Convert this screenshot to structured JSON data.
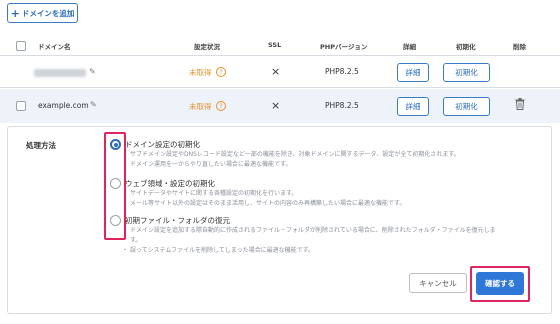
{
  "toolbar": {
    "add_domain_label": "ドメインを追加"
  },
  "table": {
    "headers": {
      "domain": "ドメイン名",
      "settings_status": "設定状況",
      "ssl": "SSL",
      "php_version": "PHPバージョン",
      "details": "詳細",
      "initialize": "初期化",
      "delete": "削除"
    },
    "rows": [
      {
        "domain": "",
        "status": "未取得",
        "ssl": "×",
        "php": "PHP8.2.5",
        "details_label": "詳細",
        "init_label": "初期化"
      },
      {
        "domain": "example.com",
        "status": "未取得",
        "ssl": "×",
        "php": "PHP8.2.5",
        "details_label": "詳細",
        "init_label": "初期化"
      }
    ]
  },
  "panel": {
    "label": "処理方法",
    "options": [
      {
        "title": "ドメイン設定の初期化",
        "desc": [
          "サブドメイン設定やDNSレコード設定など一部の機能を除き、対象ドメインに関するデータ、設定が全て初期化されます。",
          "ドメイン運用を一からやり直したい場合に最適な機能です。"
        ],
        "selected": true
      },
      {
        "title": "ウェブ領域・設定の初期化",
        "desc": [
          "サイトデータやサイトに関する各種設定の初期化を行います。",
          "メール等サイト以外の設定はそのまま活用し、サイトの内容のみ再構築したい場合に最適な機能です。"
        ],
        "selected": false
      },
      {
        "title": "初期ファイル・フォルダの復元",
        "desc": [
          "ドメイン設定を追加する際自動的に作成されるファイル・フォルダが削除されている場合に、削除されたフォルダ・ファイルを復元しま",
          "す。",
          "・ 誤ってシステムファイルを削除してしまった場合に最適な機能です。"
        ],
        "selected": false
      }
    ],
    "cancel_label": "キャンセル",
    "confirm_label": "確認する"
  },
  "colors": {
    "primary": "#2f78d8",
    "warning": "#e8902a",
    "highlight": "#e0245e",
    "row_selected_bg": "#eef3fa"
  }
}
